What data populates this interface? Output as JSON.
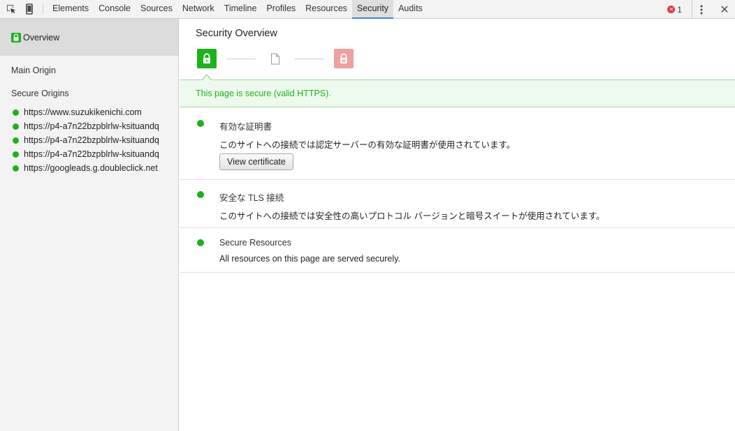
{
  "toolbar": {
    "tabs": [
      {
        "label": "Elements"
      },
      {
        "label": "Console"
      },
      {
        "label": "Sources"
      },
      {
        "label": "Network"
      },
      {
        "label": "Timeline"
      },
      {
        "label": "Profiles"
      },
      {
        "label": "Resources"
      },
      {
        "label": "Security",
        "selected": true
      },
      {
        "label": "Audits"
      }
    ],
    "error_count": "1",
    "icons": {
      "inspect": "inspect-element-icon",
      "device": "device-mode-icon",
      "error": "error-icon",
      "menu": "kebab-menu-icon",
      "close": "close-icon"
    }
  },
  "sidebar": {
    "overview_label": "Overview",
    "main_origin_label": "Main Origin",
    "secure_origins_label": "Secure Origins",
    "origins": [
      "https://www.suzukikenichi.com",
      "https://p4-a7n22bzpblrlw-ksituandq",
      "https://p4-a7n22bzpblrlw-ksituandq",
      "https://p4-a7n22bzpblrlw-ksituandq",
      "https://googleads.g.doubleclick.net"
    ]
  },
  "main": {
    "title": "Security Overview",
    "summary": "This page is secure (valid HTTPS).",
    "explanations": [
      {
        "title": "有効な証明書",
        "text": "このサイトへの接続では認定サーバーの有効な証明書が使用されています。",
        "button": "View certificate"
      },
      {
        "title": "安全な TLS 接続",
        "text": "このサイトへの接続では安全性の高いプロトコル バージョンと暗号スイートが使用されています。"
      },
      {
        "title": "Secure Resources",
        "text": "All resources on this page are served securely."
      }
    ]
  },
  "colors": {
    "secure_green": "#1ab31a",
    "insecure_red": "#ef9f9f",
    "tab_accent": "#3e82f7"
  }
}
